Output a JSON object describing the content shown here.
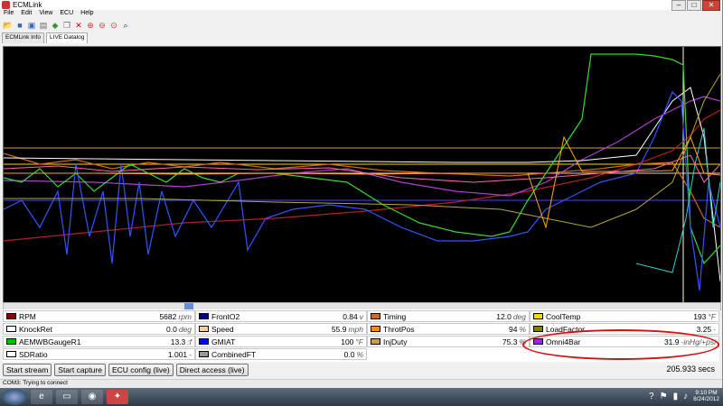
{
  "window": {
    "title": "ECMLink",
    "controls": [
      "–",
      "□",
      "✕"
    ]
  },
  "menu": [
    "File",
    "Edit",
    "View",
    "ECU",
    "Help"
  ],
  "toolbar_icons": [
    "open-icon",
    "save-icon",
    "save-as-icon",
    "print-icon",
    "connect-icon",
    "copy-icon",
    "delete-icon",
    "zoom-in-icon",
    "zoom-out-icon",
    "zoom-fit-icon",
    "search-icon"
  ],
  "tabs": [
    {
      "label": "ECMLink Info"
    },
    {
      "label": "LIVE Datalog"
    }
  ],
  "gauges": [
    {
      "name": "RPM",
      "value": "5682",
      "unit": "rpm",
      "color": "#8b0000"
    },
    {
      "name": "KnockRet",
      "value": "0.0",
      "unit": "deg",
      "color": "#ffffff"
    },
    {
      "name": "AEMWBGaugeR1",
      "value": "13.3",
      "unit": ":f",
      "color": "#00c000"
    },
    {
      "name": "SDRatio",
      "value": "1.001",
      "unit": "-",
      "color": "#ffffff"
    },
    {
      "name": "FrontO2",
      "value": "0.84",
      "unit": "v",
      "color": "#000080"
    },
    {
      "name": "Speed",
      "value": "55.9",
      "unit": "mph",
      "color": "#ffcc99"
    },
    {
      "name": "GMIAT",
      "value": "100",
      "unit": "°F",
      "color": "#0000ff"
    },
    {
      "name": "CombinedFT",
      "value": "0.0",
      "unit": "%",
      "color": "#999999"
    },
    {
      "name": "Timing",
      "value": "12.0",
      "unit": "deg",
      "color": "#d2691e"
    },
    {
      "name": "ThrotPos",
      "value": "94",
      "unit": "%",
      "color": "#ff8c00"
    },
    {
      "name": "InjDuty",
      "value": "75.3",
      "unit": "%",
      "color": "#c8a040"
    },
    {
      "name": "CoolTemp",
      "value": "193",
      "unit": "°F",
      "color": "#ffd700"
    },
    {
      "name": "LoadFactor",
      "value": "3.25",
      "unit": "-",
      "color": "#808000"
    },
    {
      "name": "Omni4Bar",
      "value": "31.9",
      "unit": "-inHg/+psi",
      "color": "#a020f0"
    }
  ],
  "buttons": {
    "start_stream": "Start stream",
    "start_capture": "Start capture",
    "ecu_config": "ECU config (live)",
    "direct_access": "Direct access (live)"
  },
  "elapsed": "205.933 secs",
  "status": "COM3: Trying to connect",
  "taskbar": {
    "clock_time": "9:10 PM",
    "clock_date": "8/24/2012"
  }
}
